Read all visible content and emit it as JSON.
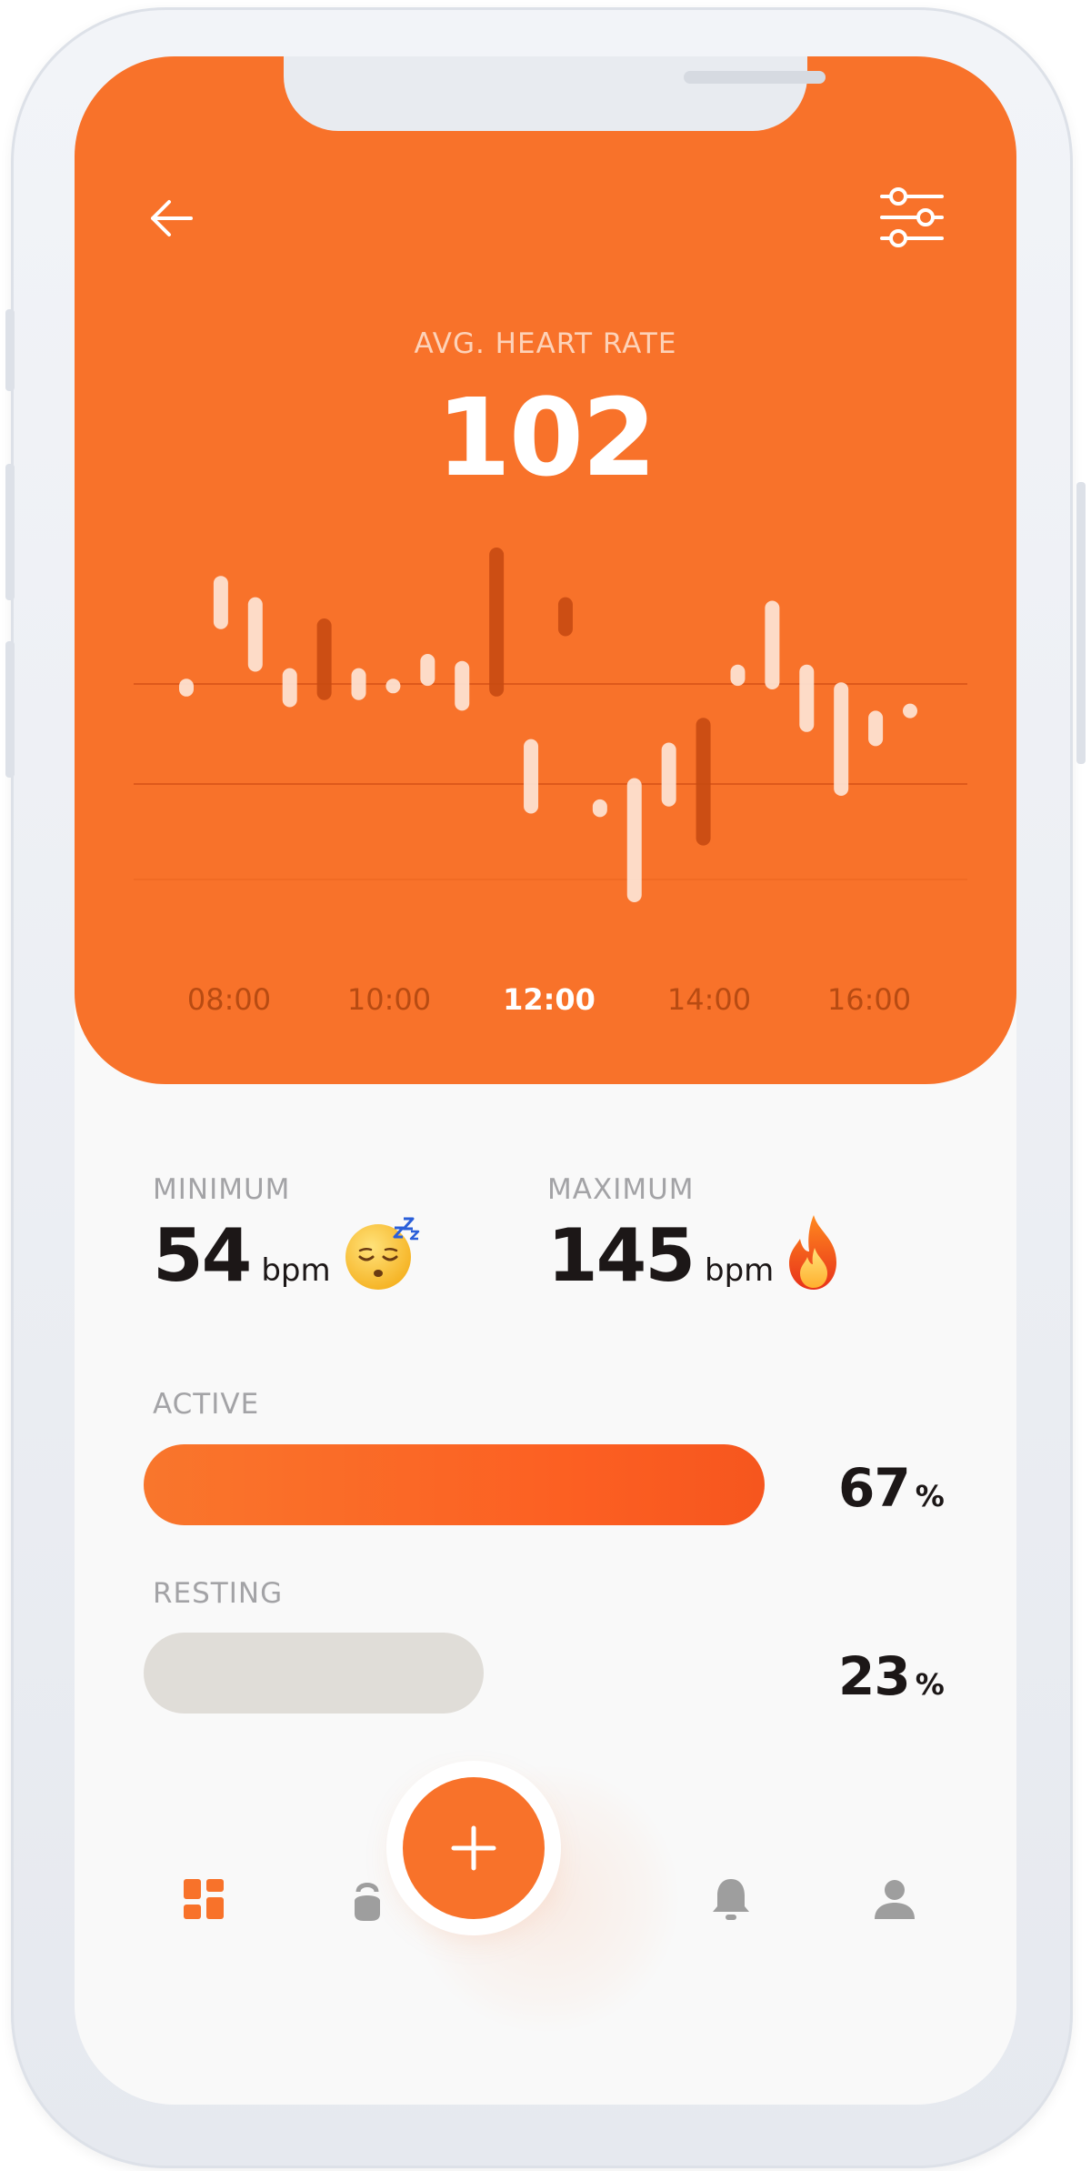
{
  "colors": {
    "accent": "#f8722a",
    "accent_dark": "#c64a12",
    "bar_light": "#fde3d3",
    "resting_bar": "#e0ddd8",
    "text_dark": "#1c1717",
    "label_gray": "#a3a3a6",
    "tab_inactive": "#9e9e9e"
  },
  "header": {
    "back_icon": "arrow-left-icon",
    "filter_icon": "sliders-icon"
  },
  "hero": {
    "label": "AVG. HEART RATE",
    "value": "102"
  },
  "chart_data": {
    "type": "bar",
    "x_ticks": [
      "08:00",
      "10:00",
      "12:00",
      "14:00",
      "16:00"
    ],
    "highlighted_tick": "12:00",
    "series": [
      {
        "values": [
          {
            "x": 0,
            "low": 0.58,
            "high": 0.63,
            "tone": "light"
          },
          {
            "x": 1,
            "low": 0.77,
            "high": 0.92,
            "tone": "light"
          },
          {
            "x": 2,
            "low": 0.65,
            "high": 0.86,
            "tone": "light"
          },
          {
            "x": 3,
            "low": 0.55,
            "high": 0.66,
            "tone": "light"
          },
          {
            "x": 4,
            "low": 0.57,
            "high": 0.8,
            "tone": "dark"
          },
          {
            "x": 5,
            "low": 0.57,
            "high": 0.66,
            "tone": "light"
          },
          {
            "x": 6,
            "low": 0.59,
            "high": 0.63,
            "tone": "light"
          },
          {
            "x": 7,
            "low": 0.61,
            "high": 0.7,
            "tone": "light"
          },
          {
            "x": 8,
            "low": 0.54,
            "high": 0.68,
            "tone": "light"
          },
          {
            "x": 9,
            "low": 0.58,
            "high": 1.0,
            "tone": "dark"
          },
          {
            "x": 10,
            "low": 0.25,
            "high": 0.46,
            "tone": "light"
          },
          {
            "x": 11,
            "low": 0.75,
            "high": 0.86,
            "tone": "dark"
          },
          {
            "x": 12,
            "low": 0.24,
            "high": 0.29,
            "tone": "light"
          },
          {
            "x": 13,
            "low": 0.0,
            "high": 0.35,
            "tone": "light"
          },
          {
            "x": 14,
            "low": 0.27,
            "high": 0.45,
            "tone": "light"
          },
          {
            "x": 15,
            "low": 0.16,
            "high": 0.52,
            "tone": "dark"
          },
          {
            "x": 16,
            "low": 0.61,
            "high": 0.67,
            "tone": "light"
          },
          {
            "x": 17,
            "low": 0.6,
            "high": 0.85,
            "tone": "light"
          },
          {
            "x": 18,
            "low": 0.48,
            "high": 0.67,
            "tone": "light"
          },
          {
            "x": 19,
            "low": 0.3,
            "high": 0.62,
            "tone": "light"
          },
          {
            "x": 20,
            "low": 0.44,
            "high": 0.54,
            "tone": "light"
          },
          {
            "x": 21,
            "low": 0.52,
            "high": 0.56,
            "tone": "light"
          }
        ]
      }
    ],
    "ylim": [
      0,
      1
    ],
    "grid": true
  },
  "stats": {
    "minimum": {
      "label": "MINIMUM",
      "value": "54",
      "unit": "bpm",
      "icon": "sleeping-face-icon"
    },
    "maximum": {
      "label": "MAXIMUM",
      "value": "145",
      "unit": "bpm",
      "icon": "fire-icon"
    }
  },
  "bars": {
    "active": {
      "label": "ACTIVE",
      "value": "67",
      "unit": "%",
      "fill": 1.0
    },
    "resting": {
      "label": "RESTING",
      "value": "23",
      "unit": "%",
      "fill": 0.547
    }
  },
  "tabbar": {
    "items": [
      {
        "icon": "dashboard-icon",
        "active": true
      },
      {
        "icon": "kettlebell-icon",
        "active": false
      },
      {
        "icon": "plus-icon",
        "active": false
      },
      {
        "icon": "bell-icon",
        "active": false
      },
      {
        "icon": "profile-icon",
        "active": false
      }
    ]
  }
}
